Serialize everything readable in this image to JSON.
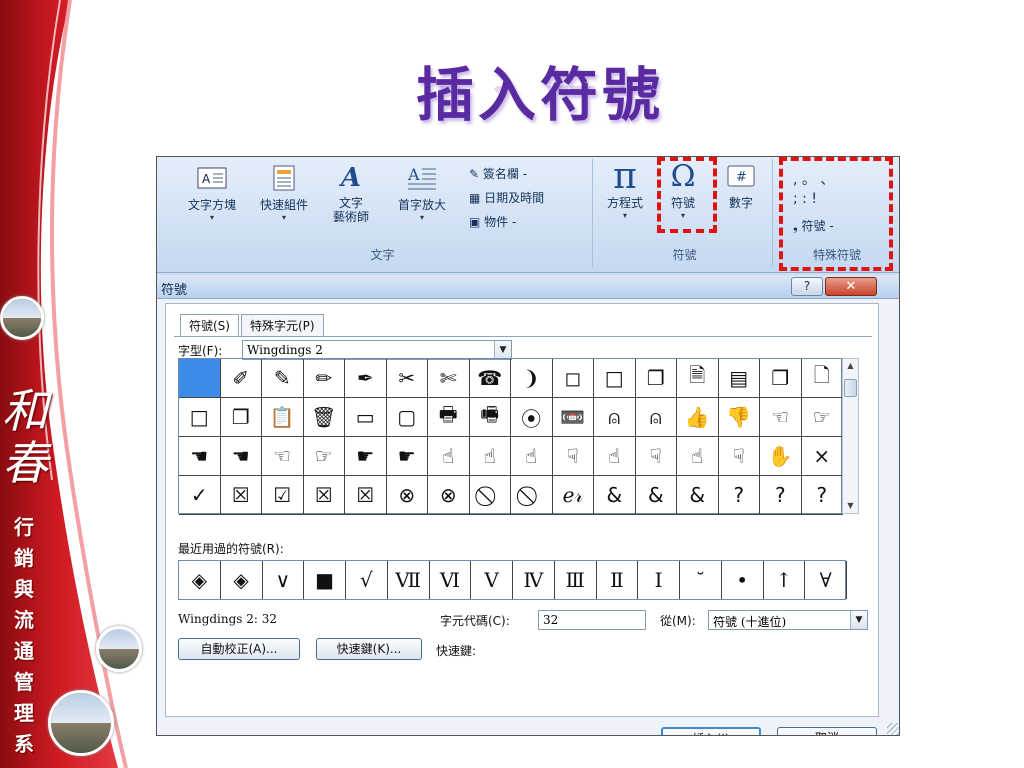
{
  "slide": {
    "title": "插入符號",
    "vertical_text": [
      "行",
      "銷",
      "與",
      "流",
      "通",
      "管",
      "理",
      "系"
    ],
    "logo_text": "和春",
    "colors": {
      "title": "#5a2aa0",
      "band": "#c8141c",
      "highlight": "#e01212"
    }
  },
  "ribbon": {
    "groups": [
      {
        "label": "文字",
        "buttons": [
          {
            "label": "文字方塊",
            "icon": "text-box-icon",
            "dropdown": true
          },
          {
            "label": "快速組件",
            "icon": "quick-parts-icon",
            "dropdown": true
          },
          {
            "label": "文字\n藝術師",
            "icon": "wordart-icon",
            "dropdown": true
          },
          {
            "label": "首字放大",
            "icon": "drop-cap-icon",
            "dropdown": true
          }
        ],
        "small_buttons": [
          {
            "label": "簽名欄 -",
            "icon": "signature-line-icon"
          },
          {
            "label": "日期及時間",
            "icon": "date-time-icon"
          },
          {
            "label": "物件 -",
            "icon": "object-icon"
          }
        ]
      },
      {
        "label": "符號",
        "buttons": [
          {
            "label": "方程式",
            "icon": "pi-icon",
            "glyph": "π",
            "dropdown": true
          },
          {
            "label": "符號",
            "icon": "omega-icon",
            "glyph": "Ω",
            "dropdown": true
          },
          {
            "label": "數字",
            "icon": "number-icon",
            "glyph": "#",
            "dropdown": false
          }
        ]
      },
      {
        "label": "特殊符號",
        "symbols_row1": ",   。   、",
        "symbols_row2": ";   :   !",
        "button": "符號 -"
      }
    ]
  },
  "dialog": {
    "title": "符號",
    "help": "?",
    "close": "✕",
    "tabs": [
      "符號(S)",
      "特殊字元(P)"
    ],
    "font_label": "字型(F):",
    "font_value": "Wingdings 2",
    "symbols": [
      "",
      "✐",
      "✎",
      "✏",
      "✒",
      "✂",
      "✄",
      "☎",
      "❩",
      "◻",
      "□",
      "❐",
      "🗎",
      "▤",
      "❐",
      "🗋",
      "□",
      "❐",
      "📋",
      "🗑",
      "▭",
      "▢",
      "🖶",
      "🖷",
      "⦿",
      "📼",
      "⍝",
      "⍝",
      "👍",
      "👎",
      "☜",
      "☞",
      "☚",
      "☚",
      "☜",
      "☞",
      "☛",
      "☛",
      "☝",
      "☝",
      "☝",
      "☟",
      "☝",
      "☟",
      "☝",
      "☟",
      "✋",
      "×",
      "✓",
      "☒",
      "☑",
      "☒",
      "☒",
      "⊗",
      "⊗",
      "⃠",
      "⃠",
      "ℯ𝓇",
      "&",
      "&",
      "&",
      "?",
      "?",
      "?"
    ],
    "recent_label": "最近用過的符號(R):",
    "recent": [
      "◈",
      "◈",
      "∨",
      "■",
      "√",
      "Ⅶ",
      "Ⅵ",
      "Ⅴ",
      "Ⅳ",
      "Ⅲ",
      "Ⅱ",
      "Ⅰ",
      "˘",
      "•",
      "↑",
      "∀"
    ],
    "font_code": "Wingdings 2: 32",
    "char_code_label": "字元代碼(C):",
    "char_code": "32",
    "from_label": "從(M):",
    "from_value": "符號 (十進位)",
    "autocorrect": "自動校正(A)...",
    "shortcut_key": "快速鍵(K)...",
    "shortcut_label": "快速鍵:",
    "insert": "插入(I)",
    "cancel": "取消"
  }
}
